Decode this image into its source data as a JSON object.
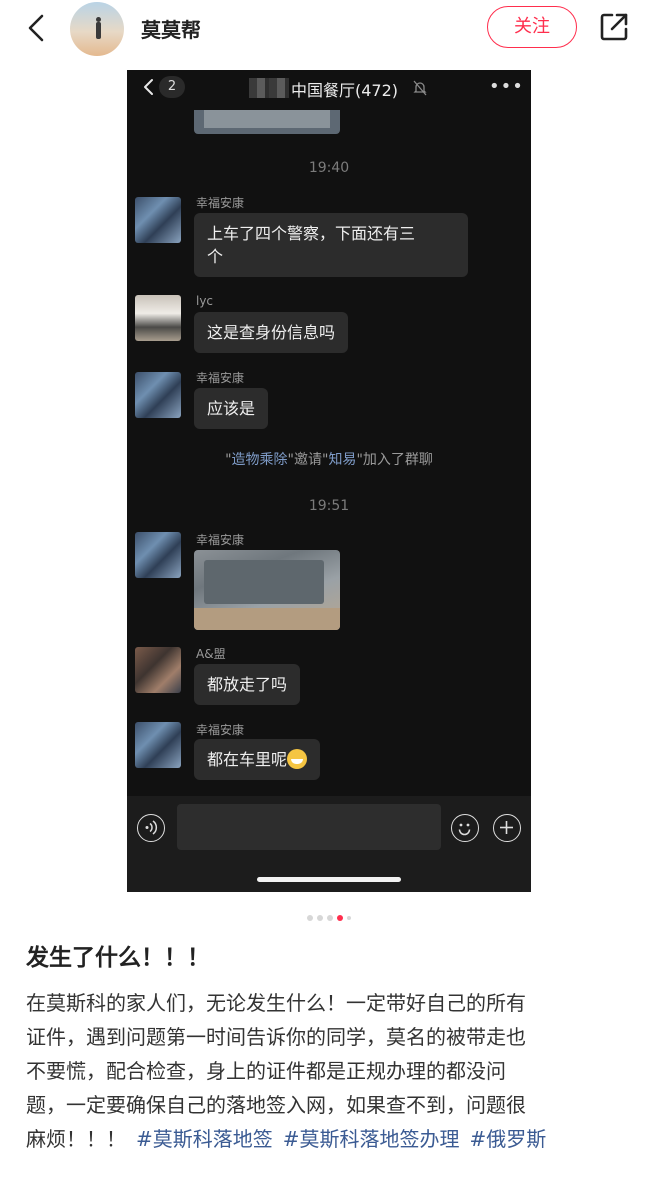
{
  "header": {
    "username": "莫莫帮",
    "follow_label": "关注"
  },
  "chat": {
    "unread_badge": "2",
    "group_title": "中国餐厅(472)",
    "more": "•••",
    "messages": [
      {
        "time": "19:40"
      },
      {
        "sender": "幸福安康",
        "text_lines": [
          "上车了四个警察，下面还有三",
          "个"
        ]
      },
      {
        "sender": "lyc",
        "text": "这是查身份信息吗"
      },
      {
        "sender": "幸福安康",
        "text": "应该是"
      },
      {
        "system": {
          "q1": "\"",
          "nick1": "造物乘除",
          "mid": "\"邀请\"",
          "nick2": "知易",
          "tail": "\"加入了群聊"
        }
      },
      {
        "time": "19:51"
      },
      {
        "sender": "幸福安康",
        "image": true
      },
      {
        "sender": "A&盟",
        "text": "都放走了吗"
      },
      {
        "sender": "幸福安康",
        "text": "都在车里呢",
        "emoji": "grinning-face"
      }
    ]
  },
  "carousel": {
    "count": 5,
    "active_index": 3
  },
  "post": {
    "title": "发生了什么！！！",
    "body_lines": [
      "在莫斯科的家人们，无论发生什么！一定带好自己的所有",
      "证件，遇到问题第一时间告诉你的同学，莫名的被带走也",
      "不要慌，配合检查，身上的证件都是正规办理的都没问",
      "题，一定要确保自己的落地签入网，如果查不到，问题很"
    ],
    "last_line_text": "麻烦！！！",
    "tags": [
      "#莫斯科落地签",
      "#莫斯科落地签办理",
      "#俄罗斯"
    ]
  },
  "colors": {
    "brand_red": "#ff2e4d",
    "tag_blue": "#3b5b93",
    "chat_bg": "#111111",
    "bubble_bg": "#2c2c2c"
  },
  "icons": [
    "back-arrow-icon",
    "share-external-icon",
    "mute-bell-icon",
    "voice-icon",
    "emoji-icon",
    "plus-icon"
  ]
}
